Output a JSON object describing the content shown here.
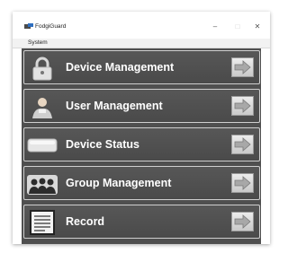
{
  "window": {
    "title": "FodgiGuard",
    "controls": {
      "minimize": "–",
      "maximize": "□",
      "close": "✕"
    }
  },
  "menubar": {
    "items": [
      "System"
    ]
  },
  "menu_buttons": [
    {
      "label": "Device Management",
      "icon": "lock-icon"
    },
    {
      "label": "User Management",
      "icon": "user-icon"
    },
    {
      "label": "Device Status",
      "icon": "device-status-icon"
    },
    {
      "label": "Group Management",
      "icon": "group-icon"
    },
    {
      "label": "Record",
      "icon": "record-icon"
    }
  ]
}
